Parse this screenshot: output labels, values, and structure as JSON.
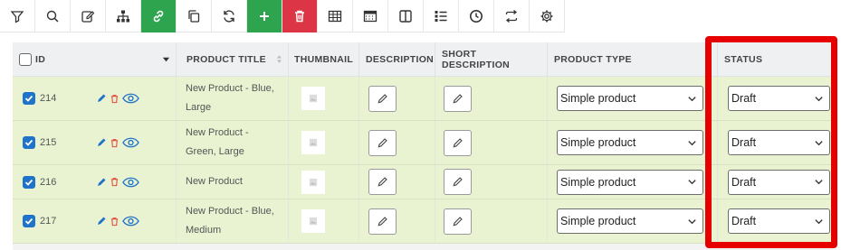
{
  "toolbar": {
    "buttons": [
      {
        "name": "filter-icon"
      },
      {
        "name": "search-icon"
      },
      {
        "name": "edit-icon"
      },
      {
        "name": "sitemap-icon"
      },
      {
        "name": "link-icon"
      },
      {
        "name": "copy-icon"
      },
      {
        "name": "refresh-icon"
      },
      {
        "name": "plus-icon"
      },
      {
        "name": "trash-icon"
      },
      {
        "name": "table-icon"
      },
      {
        "name": "spreadsheet-icon"
      },
      {
        "name": "columns-icon"
      },
      {
        "name": "list-icon"
      },
      {
        "name": "clock-icon"
      },
      {
        "name": "swap-icon"
      },
      {
        "name": "gear-icon"
      }
    ],
    "accent_green": "#2ea44f",
    "accent_red": "#dc3545"
  },
  "table": {
    "headers": {
      "id": "ID",
      "title": "PRODUCT TITLE",
      "thumbnail": "THUMBNAIL",
      "description": "DESCRIPTION",
      "short_description": "SHORT DESCRIPTION",
      "product_type": "PRODUCT TYPE",
      "status": "STATUS"
    },
    "rows": [
      {
        "id": "214",
        "title": [
          "New Product - Blue,",
          "Large"
        ],
        "product_type": "Simple product",
        "status": "Draft"
      },
      {
        "id": "215",
        "title": [
          "New Product -",
          "Green, Large"
        ],
        "product_type": "Simple product",
        "status": "Draft"
      },
      {
        "id": "216",
        "title": [
          "New Product"
        ],
        "product_type": "Simple product",
        "status": "Draft"
      },
      {
        "id": "217",
        "title": [
          "New Product - Blue,",
          "Medium"
        ],
        "product_type": "Simple product",
        "status": "Draft"
      }
    ],
    "row_color": "#e9f3d2"
  },
  "highlight_color": "#e60000"
}
